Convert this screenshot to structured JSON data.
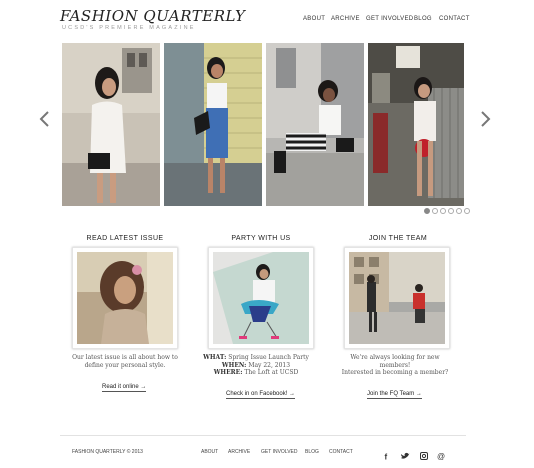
{
  "header": {
    "title": "FASHION QUARTERLY",
    "subtitle": "UCSD'S PREMIERE MAGAZINE",
    "nav": [
      "ABOUT",
      "ARCHIVE",
      "GET INVOLVED",
      "BLOG",
      "CONTACT"
    ]
  },
  "carousel": {
    "slide_count": 6,
    "active_index": 0
  },
  "columns": {
    "issue": {
      "title": "READ LATEST ISSUE",
      "desc": "Our latest issue is all about how to define your personal style.",
      "link": "Read it online →"
    },
    "party": {
      "title": "PARTY WITH US",
      "what_label": "WHAT:",
      "what_value": "Spring Issue Launch Party",
      "when_label": "WHEN:",
      "when_value": "May 22, 2013",
      "where_label": "WHERE:",
      "where_value": "The Loft at UCSD",
      "link": "Check in on Facebook! →"
    },
    "team": {
      "title": "JOIN THE TEAM",
      "desc_1": "We're always looking for new members!",
      "desc_2": "Interested in becoming a member?",
      "link": "Join the FQ Team →"
    }
  },
  "footer": {
    "copyright": "FASHION QUARTERLY © 2013",
    "nav": [
      "ABOUT",
      "ARCHIVE",
      "GET INVOLVED",
      "BLOG",
      "CONTACT"
    ],
    "social": [
      "facebook-icon",
      "twitter-icon",
      "instagram-icon",
      "email-icon"
    ]
  },
  "colors": {
    "accent_red": "#c0202a",
    "text_dark": "#222222",
    "text_gray": "#9a9a9a"
  }
}
